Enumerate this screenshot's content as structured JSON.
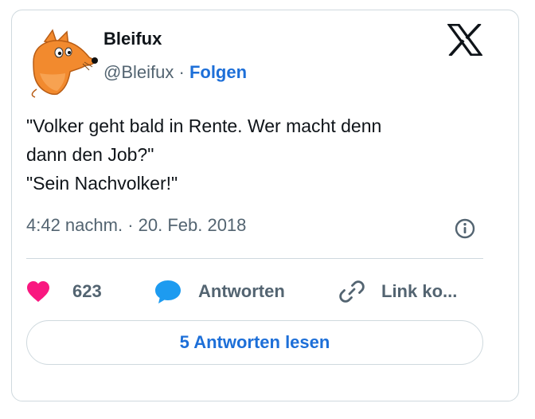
{
  "author": {
    "name": "Bleifux",
    "handle": "@Bleifux",
    "separator": " · ",
    "follow_label": "Folgen"
  },
  "tweet": {
    "lines": [
      "\"Volker geht bald in Rente. Wer macht denn",
      "dann den Job?\"",
      "\"Sein Nachvolker!\""
    ],
    "timestamp": "4:42 nachm. · 20. Feb. 2018"
  },
  "actions": {
    "like_count": "623",
    "reply_label": "Antworten",
    "copy_link_label": "Link ko..."
  },
  "read_replies_label": "5 Antworten lesen",
  "colors": {
    "like_heart": "#f91880",
    "reply_bubble": "#1d9bf0",
    "link_text": "#1d6fd8",
    "secondary_text": "#536471",
    "primary_text": "#0f1419",
    "border": "#cfd9de",
    "avatar_fox": "#f28a2e"
  },
  "icons": {
    "avatar": "fox-avatar",
    "platform_logo": "x-logo-icon",
    "info": "info-icon",
    "like": "heart-icon",
    "reply": "speech-bubble-icon",
    "copy": "link-icon"
  }
}
